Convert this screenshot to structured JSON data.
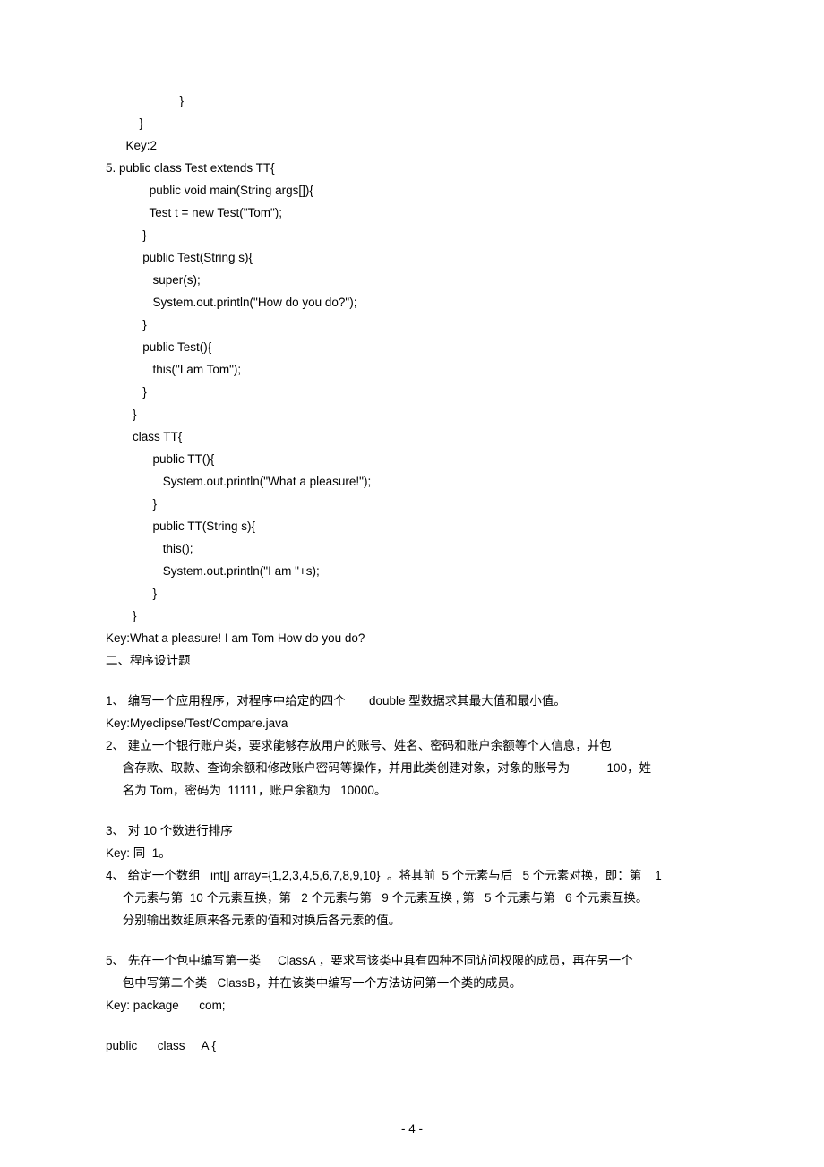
{
  "lines": {
    "c1": "                      }",
    "c2": "          }",
    "c3": "      Key:2",
    "c4": "5. public class Test extends TT{",
    "c5": "             public void main(String args[]){",
    "c6": "             Test t = new Test(\"Tom\");",
    "c7": "           }",
    "c8": "           public Test(String s){",
    "c9": "              super(s);",
    "c10": "              System.out.println(\"How do you do?\");",
    "c11": "           }",
    "c12": "           public Test(){",
    "c13": "              this(\"I am Tom\");",
    "c14": "           }",
    "c15": "        }",
    "c16": "        class TT{",
    "c17": "              public TT(){",
    "c18": "                 System.out.println(\"What a pleasure!\");",
    "c19": "              }",
    "c20": "              public TT(String s){",
    "c21": "                 this();",
    "c22": "                 System.out.println(\"I am \"+s);",
    "c23": "              }",
    "c24": "        }",
    "c25": "Key:What a pleasure! I am Tom How do you do?",
    "s2": "二、程序设计题",
    "q1": "1、 编写一个应用程序，对程序中给定的四个       double 型数据求其最大值和最小值。",
    "k1": "Key:Myeclipse/Test/Compare.java",
    "q2a": "2、 建立一个银行账户类，要求能够存放用户的账号、姓名、密码和账户余额等个人信息，并包",
    "q2b": "     含存款、取款、查询余额和修改账户密码等操作，并用此类创建对象，对象的账号为           100，姓",
    "q2c": "     名为 Tom，密码为  11111，账户余额为   10000。",
    "q3": "3、 对 10 个数进行排序",
    "k3": "Key: 同  1。",
    "q4a": "4、 给定一个数组   int[] array={1,2,3,4,5,6,7,8,9,10}  。将其前  5 个元素与后   5 个元素对换，即：第    1",
    "q4b": "     个元素与第  10 个元素互换，第   2 个元素与第   9 个元素互换 , 第   5 个元素与第   6 个元素互换。",
    "q4c": "     分别输出数组原来各元素的值和对换后各元素的值。",
    "q5a": "5、 先在一个包中编写第一类     ClassA ，要求写该类中具有四种不同访问权限的成员，再在另一个",
    "q5b": "     包中写第二个类   ClassB，并在该类中编写一个方法访问第一个类的成员。",
    "k5": "Key: package      com;",
    "k5b": "public      class     A {"
  },
  "footer": "- 4 -"
}
